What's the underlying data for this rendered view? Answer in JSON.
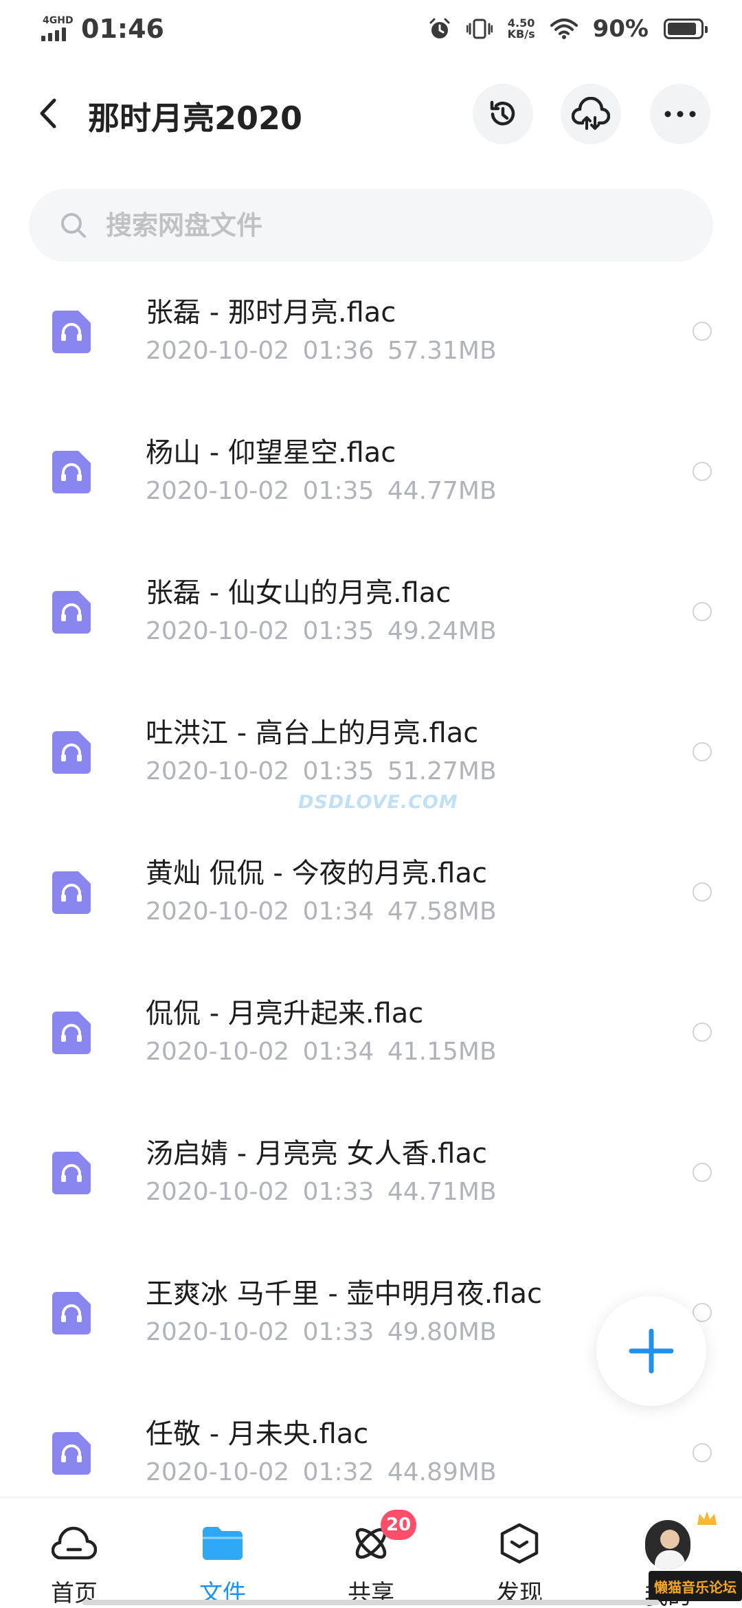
{
  "status_bar": {
    "network": "4GHD",
    "time": "01:46",
    "speed_value": "4.50",
    "speed_unit": "KB/s",
    "battery_percent": "90%",
    "battery_level": 0.9
  },
  "header": {
    "title": "那时月亮2020",
    "icons": [
      "back-arrow",
      "history",
      "cloud-upload",
      "more"
    ]
  },
  "search": {
    "placeholder": "搜索网盘文件",
    "value": ""
  },
  "files": [
    {
      "name": "张磊 - 那时月亮.flac",
      "meta": "2020-10-02 01:36 57.31MB"
    },
    {
      "name": "杨山 - 仰望星空.flac",
      "meta": "2020-10-02 01:35 44.77MB"
    },
    {
      "name": "张磊 - 仙女山的月亮.flac",
      "meta": "2020-10-02 01:35 49.24MB"
    },
    {
      "name": "吐洪江 - 高台上的月亮.flac",
      "meta": "2020-10-02 01:35 51.27MB"
    },
    {
      "name": "黄灿 侃侃 - 今夜的月亮.flac",
      "meta": "2020-10-02 01:34 47.58MB"
    },
    {
      "name": "侃侃 - 月亮升起来.flac",
      "meta": "2020-10-02 01:34 41.15MB"
    },
    {
      "name": "汤启婧 - 月亮亮 女人香.flac",
      "meta": "2020-10-02 01:33 44.71MB"
    },
    {
      "name": "王爽冰 马千里 - 壶中明月夜.flac",
      "meta": "2020-10-02 01:33 49.80MB"
    },
    {
      "name": "任敬 - 月未央.flac",
      "meta": "2020-10-02 01:32 44.89MB"
    }
  ],
  "watermark": "DSDLOVE.COM",
  "bottom_nav": {
    "home": "首页",
    "files": "文件",
    "share": "共享",
    "share_badge": "20",
    "discover": "发现",
    "mine": "我的"
  },
  "forum_mark": "懒猫音乐论坛",
  "colors": {
    "accent": "#1e90f0",
    "file_icon": "#8a86f0",
    "badge": "#ff4d6a"
  }
}
